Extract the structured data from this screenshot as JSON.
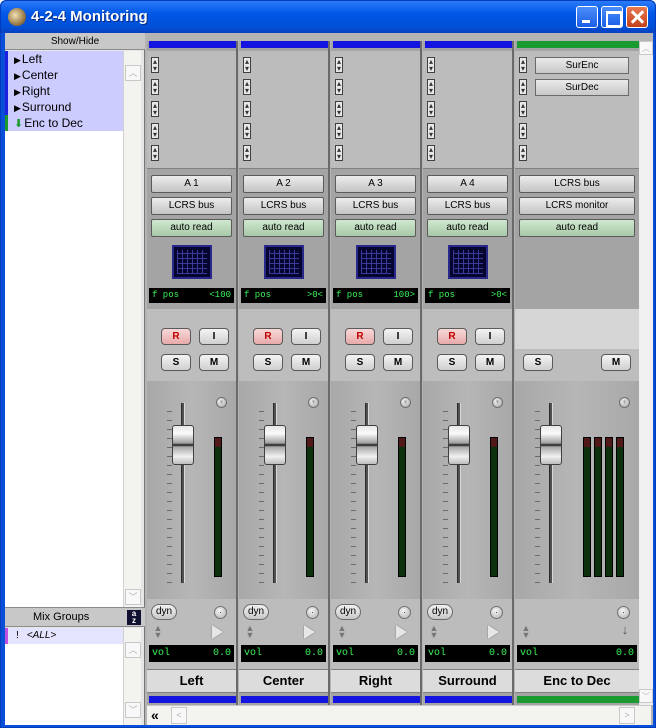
{
  "window": {
    "title": "4-2-4 Monitoring"
  },
  "showhide": {
    "header": "Show/Hide",
    "tracks": [
      {
        "label": "Left",
        "color": "blue"
      },
      {
        "label": "Center",
        "color": "blue"
      },
      {
        "label": "Right",
        "color": "blue"
      },
      {
        "label": "Surround",
        "color": "blue"
      },
      {
        "label": "Enc to Dec",
        "color": "green"
      }
    ]
  },
  "mix_groups": {
    "header": "Mix Groups",
    "az_top": "a",
    "az_bottom": "z",
    "items": [
      {
        "flag": "!",
        "label": "<ALL>"
      }
    ]
  },
  "strips": [
    {
      "name": "Left",
      "color": "#1414e0",
      "input": "A 1",
      "output": "LCRS bus",
      "auto": "auto read",
      "pan_label": "f pos",
      "pan_value": "<100",
      "rec": "R",
      "input_btn": "I",
      "solo": "S",
      "mute": "M",
      "dyn": "dyn",
      "vol_label": "vol",
      "vol_value": "0.0"
    },
    {
      "name": "Center",
      "color": "#1414e0",
      "input": "A 2",
      "output": "LCRS bus",
      "auto": "auto read",
      "pan_label": "f pos",
      "pan_value": ">0<",
      "rec": "R",
      "input_btn": "I",
      "solo": "S",
      "mute": "M",
      "dyn": "dyn",
      "vol_label": "vol",
      "vol_value": "0.0"
    },
    {
      "name": "Right",
      "color": "#1414e0",
      "input": "A 3",
      "output": "LCRS bus",
      "auto": "auto read",
      "pan_label": "f pos",
      "pan_value": "100>",
      "rec": "R",
      "input_btn": "I",
      "solo": "S",
      "mute": "M",
      "dyn": "dyn",
      "vol_label": "vol",
      "vol_value": "0.0"
    },
    {
      "name": "Surround",
      "color": "#1414e0",
      "input": "A 4",
      "output": "LCRS bus",
      "auto": "auto read",
      "pan_label": "f pos",
      "pan_value": ">0<",
      "rec": "R",
      "input_btn": "I",
      "solo": "S",
      "mute": "M",
      "dyn": "dyn",
      "vol_label": "vol",
      "vol_value": "0.0"
    },
    {
      "name": "Enc to Dec",
      "color": "#1a9a30",
      "inserts": [
        "SurEnc",
        "SurDec"
      ],
      "input": "LCRS bus",
      "output": "LCRS monitor",
      "auto": "auto read",
      "solo": "S",
      "mute": "M",
      "vol_label": "vol",
      "vol_value": "0.0"
    }
  ],
  "icons": {
    "pan_knob": "knob-icon",
    "scroll_left": "double-left-arrow-icon"
  }
}
